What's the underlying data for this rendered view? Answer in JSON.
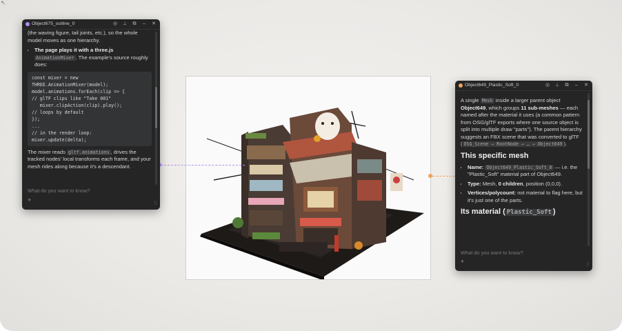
{
  "corner_mark": "↖",
  "left_panel": {
    "title": "Object675_outline_0",
    "accent": "#b48df2",
    "intro_text": "(the waving figure, tail joints, etc.), so the whole model moves as one hierarchy.",
    "bullet_bold": "The page plays it with a three.js",
    "bullet_chip": "AnimationMixer",
    "bullet_rest": ". The example's source roughly does:",
    "code": "const mixer = new\nTHREE.AnimationMixer(model);\nmodel.animations.forEach(clip => {\n// glTF clips like \"Take 001\"\n   mixer.clipAction(clip).play();\n// loops by default\n});\n...\n// in the render loop:\nmixer.update(delta);",
    "para_start": "The mixer reads",
    "para_chip": "gltf.animations",
    "para_rest": ", drives the tracked nodes' local transforms each frame, and your mesh rides along because it's a descendant.",
    "input_placeholder": "What do you want to know?",
    "plus": "+",
    "grip": "⠿"
  },
  "right_panel": {
    "title": "Object649_Plastic_Soft_0",
    "accent": "#f0a35a",
    "p1_a": "A single",
    "p1_chip": "Mesh",
    "p1_b": "inside a larger parent object",
    "p1_bold1": "Object649",
    "p1_c": ", which groups",
    "p1_bold2": "11 sub-meshes",
    "p1_d": "— each named after the material it uses (a common pattern from OSG/glTF exports where one source object is split into multiple draw \"parts\"). The parent hierarchy suggests an FBX scene that was converted to glTF (",
    "p1_chip2": "OSG_Scene → RootNode → … → Object649",
    "p1_e": ").",
    "heading1": "This specific mesh",
    "item1_label": "Name:",
    "item1_chip": "Object649_Plastic_Soft_0",
    "item1_rest": "— i.e. the \"Plastic_Soft\" material part of Object649.",
    "item2_label": "Type:",
    "item2_rest": "Mesh,",
    "item2_bold": "0 children",
    "item2_end": ", position (0,0,0).",
    "item3_label": "Vertices/polycount:",
    "item3_rest": "not material to flag here, but it's just one of the parts.",
    "heading2_a": "Its material (",
    "heading2_chip": "Plastic_Soft",
    "heading2_b": ")",
    "input_placeholder": "What do you want to know?",
    "plus": "+",
    "grip": "⠿"
  },
  "header_icons": {
    "globe": "◎",
    "pin": "⊥",
    "copy": "⧉",
    "minimize": "–",
    "close": "✕"
  }
}
